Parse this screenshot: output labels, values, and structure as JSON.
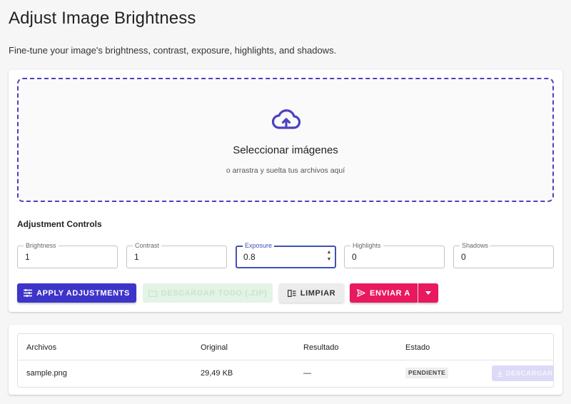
{
  "page": {
    "title": "Adjust Image Brightness",
    "subtitle": "Fine-tune your image's brightness, contrast, exposure, highlights, and shadows."
  },
  "dropzone": {
    "icon": "cloud-upload-icon",
    "title": "Seleccionar imágenes",
    "subtitle": "o arrastra y suelta tus archivos aquí"
  },
  "controls": {
    "title": "Adjustment Controls",
    "fields": [
      {
        "label": "Brightness",
        "value": "1"
      },
      {
        "label": "Contrast",
        "value": "1"
      },
      {
        "label": "Exposure",
        "value": "0.8"
      },
      {
        "label": "Highlights",
        "value": "0"
      },
      {
        "label": "Shadows",
        "value": "0"
      }
    ]
  },
  "actions": {
    "apply": "Apply Adjustments",
    "download_all": "Descargar todo (.zip)",
    "clear": "Limpiar",
    "send_to": "Enviar a"
  },
  "table": {
    "headers": [
      "Archivos",
      "Original",
      "Resultado",
      "Estado"
    ],
    "rows": [
      {
        "file": "sample.png",
        "original": "29,49 KB",
        "result": "—",
        "status": "PENDIENTE",
        "action": "Descargar"
      }
    ]
  },
  "colors": {
    "primary": "#3d35c9",
    "accent": "#e8195e",
    "success_disabled": "#e3f3e6",
    "dropzone_border": "#4a42c2"
  }
}
